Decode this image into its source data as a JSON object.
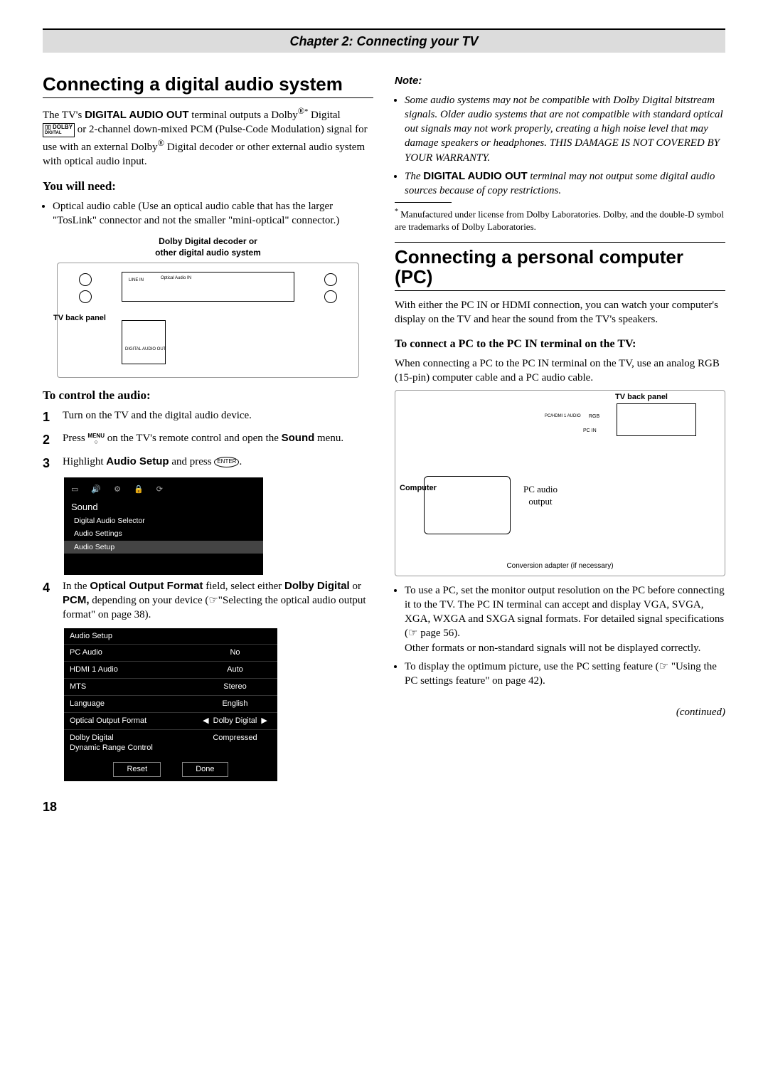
{
  "chapter_header": "Chapter 2: Connecting your TV",
  "left": {
    "h1": "Connecting a digital audio system",
    "intro_a": "The TV's ",
    "intro_b": "DIGITAL AUDIO OUT",
    "intro_c": " terminal outputs a Dolby",
    "intro_d": " Digital ",
    "intro_e": " or 2-channel down-mixed PCM (Pulse-Code Modulation) signal for use with an external Dolby",
    "intro_f": " Digital decoder or other external audio system with optical audio input.",
    "you_will_need": "You will need:",
    "need_item": "Optical audio cable (Use an optical audio cable that has the larger \"TosLink\" connector and not the smaller \"mini-optical\" connector.)",
    "diag1_caption": "Dolby Digital decoder or\nother digital audio system",
    "diag1_tvback": "TV back panel",
    "diag1_linein": "LINE IN",
    "diag1_optical": "Optical Audio IN",
    "diag1_daout": "DIGITAL AUDIO OUT",
    "to_control": "To control the audio:",
    "step1": "Turn on the TV and the digital audio device.",
    "step2_a": "Press ",
    "step2_menu": "MENU",
    "step2_b": " on the TV's remote control and open the ",
    "step2_c": "Sound",
    "step2_d": " menu.",
    "step3_a": "Highlight ",
    "step3_b": "Audio Setup",
    "step3_c": " and press ",
    "step3_enter": "ENTER",
    "step3_d": ".",
    "menu": {
      "title": "Sound",
      "items": [
        "Digital Audio Selector",
        "Audio Settings",
        "Audio Setup"
      ]
    },
    "step4_a": "In the ",
    "step4_b": "Optical Output Format",
    "step4_c": " field, select either ",
    "step4_d": "Dolby Digital",
    "step4_e": " or ",
    "step4_f": "PCM,",
    "step4_g": " depending on your device (☞\"Selecting the optical audio output format\" on page 38).",
    "audio_setup": {
      "title": "Audio Setup",
      "rows": [
        {
          "k": "PC Audio",
          "v": "No"
        },
        {
          "k": "HDMI 1 Audio",
          "v": "Auto"
        },
        {
          "k": "MTS",
          "v": "Stereo"
        },
        {
          "k": "Language",
          "v": "English"
        },
        {
          "k": "Optical Output Format",
          "v": "Dolby Digital",
          "sel": true
        },
        {
          "k": "Dolby Digital\nDynamic Range Control",
          "v": "Compressed"
        }
      ],
      "reset": "Reset",
      "done": "Done"
    }
  },
  "right": {
    "note_h": "Note:",
    "note1": "Some audio systems may not be compatible with Dolby Digital bitstream signals. Older audio systems that are not compatible with standard optical out signals may not work properly, creating a high noise level that may damage speakers or headphones. THIS DAMAGE IS NOT COVERED BY YOUR WARRANTY.",
    "note2_a": "The ",
    "note2_b": "DIGITAL AUDIO OUT",
    "note2_c": " terminal may not output some digital audio sources because of copy restrictions.",
    "footnote": "Manufactured under license from Dolby Laboratories. Dolby, and the double-D symbol are trademarks of Dolby Laboratories.",
    "h1": "Connecting a personal computer (PC)",
    "pc_intro": "With either the PC IN or HDMI connection, you can watch your computer's display on the TV and hear the sound from the TV's speakers.",
    "pc_sub": "To connect a PC to the PC IN terminal on the TV:",
    "pc_sub_text": "When connecting a PC to the PC IN terminal on the TV, use an analog RGB (15-pin) computer cable and a PC audio cable.",
    "diag2_tvback": "TV back panel",
    "diag2_computer": "Computer",
    "diag2_pcaudio": "PC audio\noutput",
    "diag2_pchdmi": "PC/HDMI 1 AUDIO",
    "diag2_rgb": "RGB",
    "diag2_pcin": "PC IN",
    "diag2_conv": "Conversion adapter (if necessary)",
    "bul1": "To use a PC, set the monitor output resolution on the PC before connecting it to the TV. The PC IN terminal can accept and display VGA, SVGA, XGA, WXGA and SXGA signal formats. For detailed signal specifications (☞ page 56).\nOther formats or non-standard signals will not be displayed correctly.",
    "bul2": "To display the optimum picture, use the PC setting feature (☞ \"Using the PC settings feature\" on page 42).",
    "continued": "(continued)"
  },
  "page_number": "18"
}
